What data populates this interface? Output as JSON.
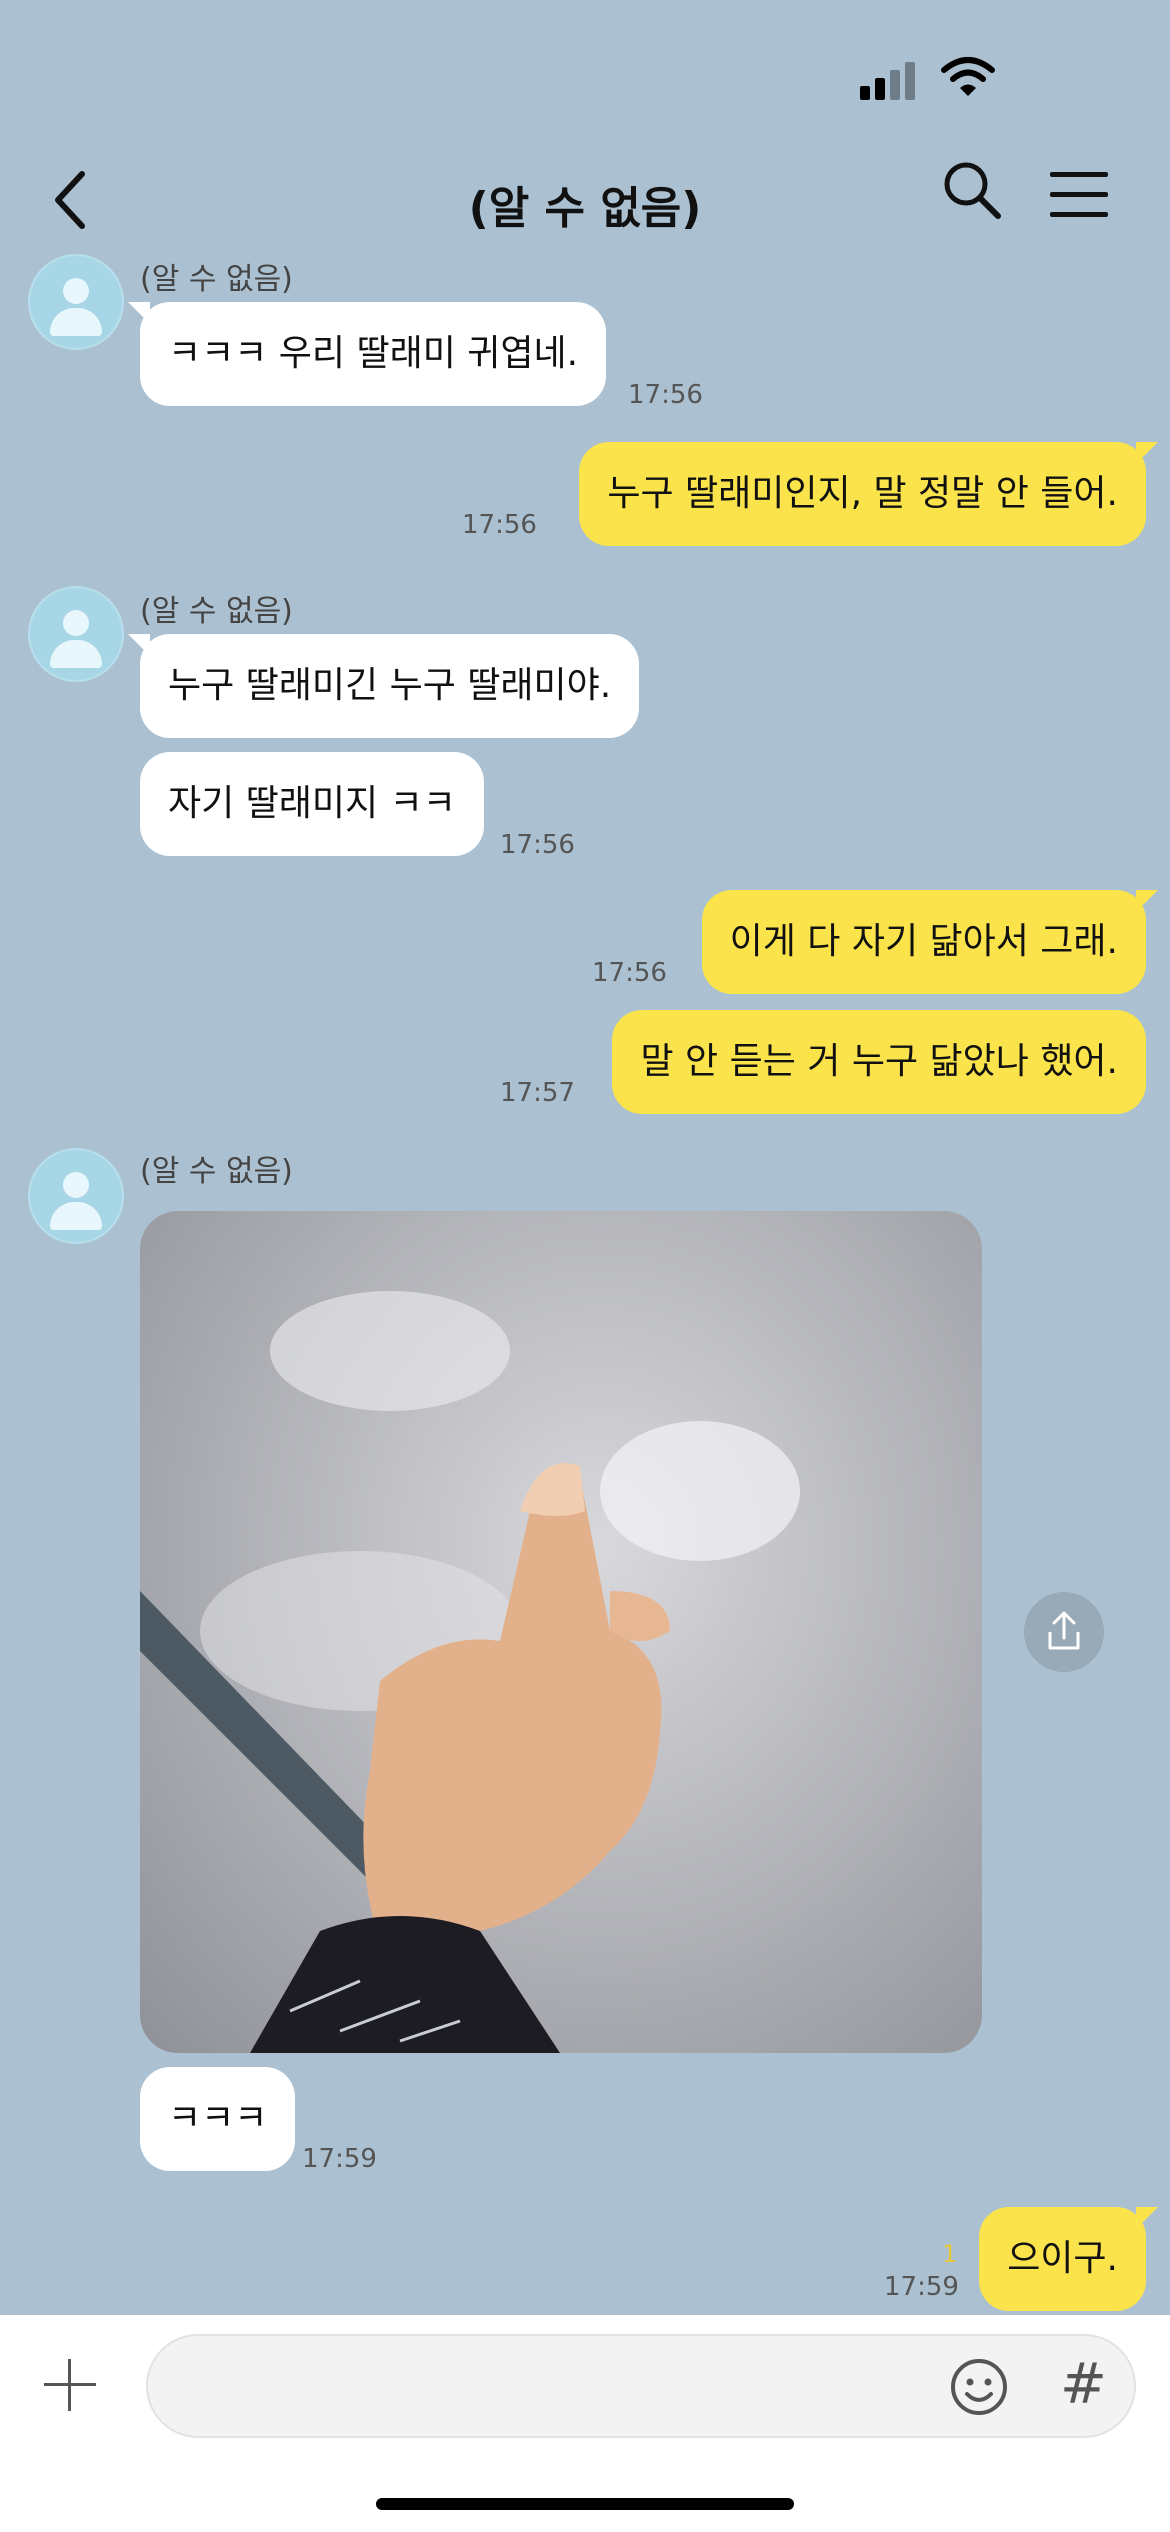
{
  "header": {
    "title": "(알 수 없음)"
  },
  "messages": [
    {
      "sender": "(알 수 없음)",
      "text": "ㅋㅋㅋ 우리 딸래미 귀엽네.",
      "time": "17:56"
    },
    {
      "text": "누구 딸래미인지, 말 정말 안 들어.",
      "time": "17:56"
    },
    {
      "sender": "(알 수 없음)",
      "text": "누구 딸래미긴 누구 딸래미야."
    },
    {
      "text": "자기 딸래미지 ㅋㅋ",
      "time": "17:56"
    },
    {
      "text": "이게 다 자기 닮아서 그래.",
      "time": "17:56"
    },
    {
      "text": "말 안 듣는 거 누구 닮았나 했어.",
      "time": "17:57"
    },
    {
      "sender": "(알 수 없음)"
    },
    {
      "text": "ㅋㅋㅋ",
      "time": "17:59"
    },
    {
      "text": "으이구.",
      "time": "17:59",
      "unread": "1"
    }
  ],
  "colors": {
    "background": "#abc1d1",
    "incoming": "#ffffff",
    "outgoing": "#fbe44b"
  },
  "icons": [
    "back-chevron-icon",
    "search-icon",
    "menu-icon",
    "share-icon",
    "plus-icon",
    "emoji-icon",
    "hash-icon"
  ]
}
